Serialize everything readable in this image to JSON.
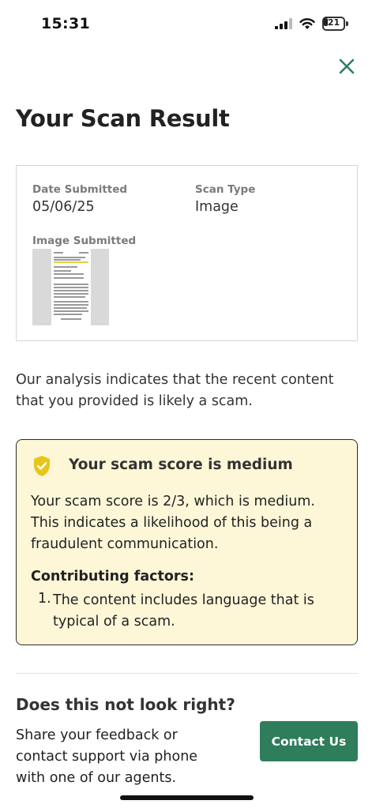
{
  "status_bar": {
    "time": "15:31",
    "battery": "21",
    "battery_level": 0.21
  },
  "close_icon": "close-icon",
  "page_title": "Your Scan Result",
  "submission": {
    "date_label": "Date Submitted",
    "date_value": "05/06/25",
    "type_label": "Scan Type",
    "type_value": "Image",
    "image_label": "Image Submitted"
  },
  "analysis_text": "Our analysis indicates that the recent content that you provided is likely a scam.",
  "score_card": {
    "title": "Your scam score is medium",
    "description": "Your scam score is 2/3, which is medium. This indicates a likelihood of this being a fraudulent communication.",
    "factors_title": "Contributing factors:",
    "factors": [
      {
        "number": "1.",
        "text": "The content includes language that is typical of a scam."
      }
    ],
    "accent_color": "#e8c51a",
    "background_color": "#fdf7d8"
  },
  "feedback": {
    "title": "Does this not look right?",
    "text": "Share your feedback or contact support via phone with one of our agents.",
    "contact_button": "Contact Us",
    "button_color": "#2e7d5b"
  }
}
